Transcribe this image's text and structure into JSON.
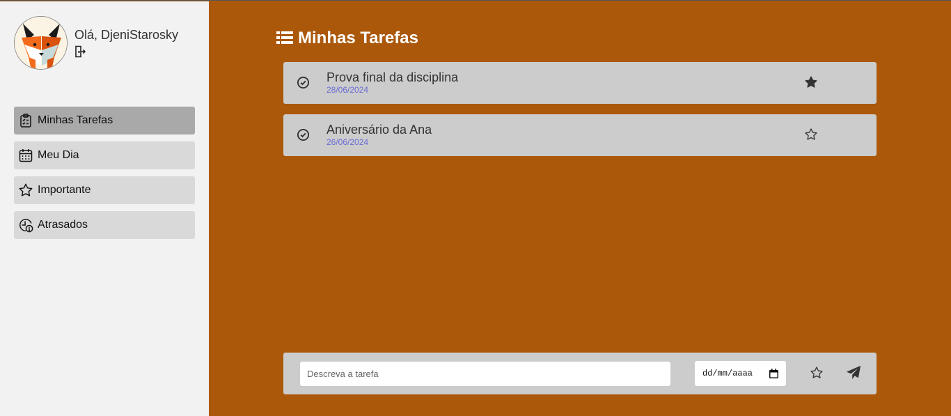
{
  "user": {
    "greeting": "Olá, DjeniStarosky",
    "avatar_icon": "fox-avatar",
    "logout_icon": "logout-icon"
  },
  "sidebar": {
    "items": [
      {
        "label": "Minhas Tarefas",
        "icon": "clipboard-list-icon",
        "active": true
      },
      {
        "label": "Meu Dia",
        "icon": "calendar-icon",
        "active": false
      },
      {
        "label": "Importante",
        "icon": "star-icon",
        "active": false
      },
      {
        "label": "Atrasados",
        "icon": "clock-alert-icon",
        "active": false
      }
    ]
  },
  "main": {
    "title": "Minhas Tarefas",
    "title_icon": "list-icon"
  },
  "tasks": [
    {
      "title": "Prova final da disciplina",
      "date": "28/06/2024",
      "important": true
    },
    {
      "title": "Aniversário da Ana",
      "date": "26/06/2024",
      "important": false
    }
  ],
  "composer": {
    "placeholder": "Descreva a tarefa",
    "date_placeholder": "dd/mm/aaaa",
    "star_icon": "star-outline-icon",
    "send_icon": "send-icon"
  },
  "colors": {
    "background": "#ab580a",
    "sidebar": "#f2f2f2",
    "card": "#cccccc",
    "date_text": "#6b6bd6"
  }
}
